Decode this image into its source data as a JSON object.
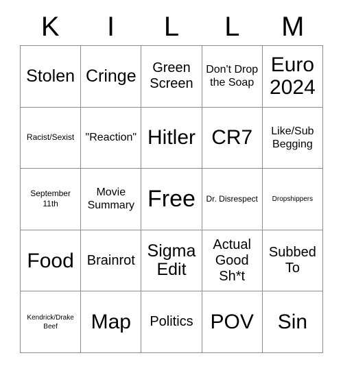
{
  "card": {
    "header_letters": [
      "K",
      "I",
      "L",
      "L",
      "M"
    ],
    "colors": {
      "background": "#ffffff",
      "text": "#000000",
      "grid_line": "#8c8c8c"
    },
    "grid": {
      "rows": 5,
      "columns": 5,
      "cells": [
        {
          "text": "Stolen",
          "size": "fs-lg"
        },
        {
          "text": "Cringe",
          "size": "fs-lg"
        },
        {
          "text": "Green Screen",
          "size": "fs-md"
        },
        {
          "text": "Don't Drop the Soap",
          "size": "fs-sm"
        },
        {
          "text": "Euro 2024",
          "size": "fs-xl"
        },
        {
          "text": "Racist/Sexist",
          "size": "fs-xs"
        },
        {
          "text": "\"Reaction\"",
          "size": "fs-sm"
        },
        {
          "text": "Hitler",
          "size": "fs-xl"
        },
        {
          "text": "CR7",
          "size": "fs-xl"
        },
        {
          "text": "Like/Sub Begging",
          "size": "fs-sm"
        },
        {
          "text": "September 11th",
          "size": "fs-xs"
        },
        {
          "text": "Movie Summary",
          "size": "fs-sm"
        },
        {
          "text": "Free",
          "size": "fs-xxl"
        },
        {
          "text": "Dr. Disrespect",
          "size": "fs-xs"
        },
        {
          "text": "Dropshippers",
          "size": "fs-xxs"
        },
        {
          "text": "Food",
          "size": "fs-xl"
        },
        {
          "text": "Brainrot",
          "size": "fs-md"
        },
        {
          "text": "Sigma Edit",
          "size": "fs-lg"
        },
        {
          "text": "Actual Good Sh*t",
          "size": "fs-md"
        },
        {
          "text": "Subbed To",
          "size": "fs-md"
        },
        {
          "text": "Kendrick/Drake Beef",
          "size": "fs-xxs"
        },
        {
          "text": "Map",
          "size": "fs-xl"
        },
        {
          "text": "Politics",
          "size": "fs-md"
        },
        {
          "text": "POV",
          "size": "fs-xl"
        },
        {
          "text": "Sin",
          "size": "fs-xl"
        }
      ]
    }
  }
}
